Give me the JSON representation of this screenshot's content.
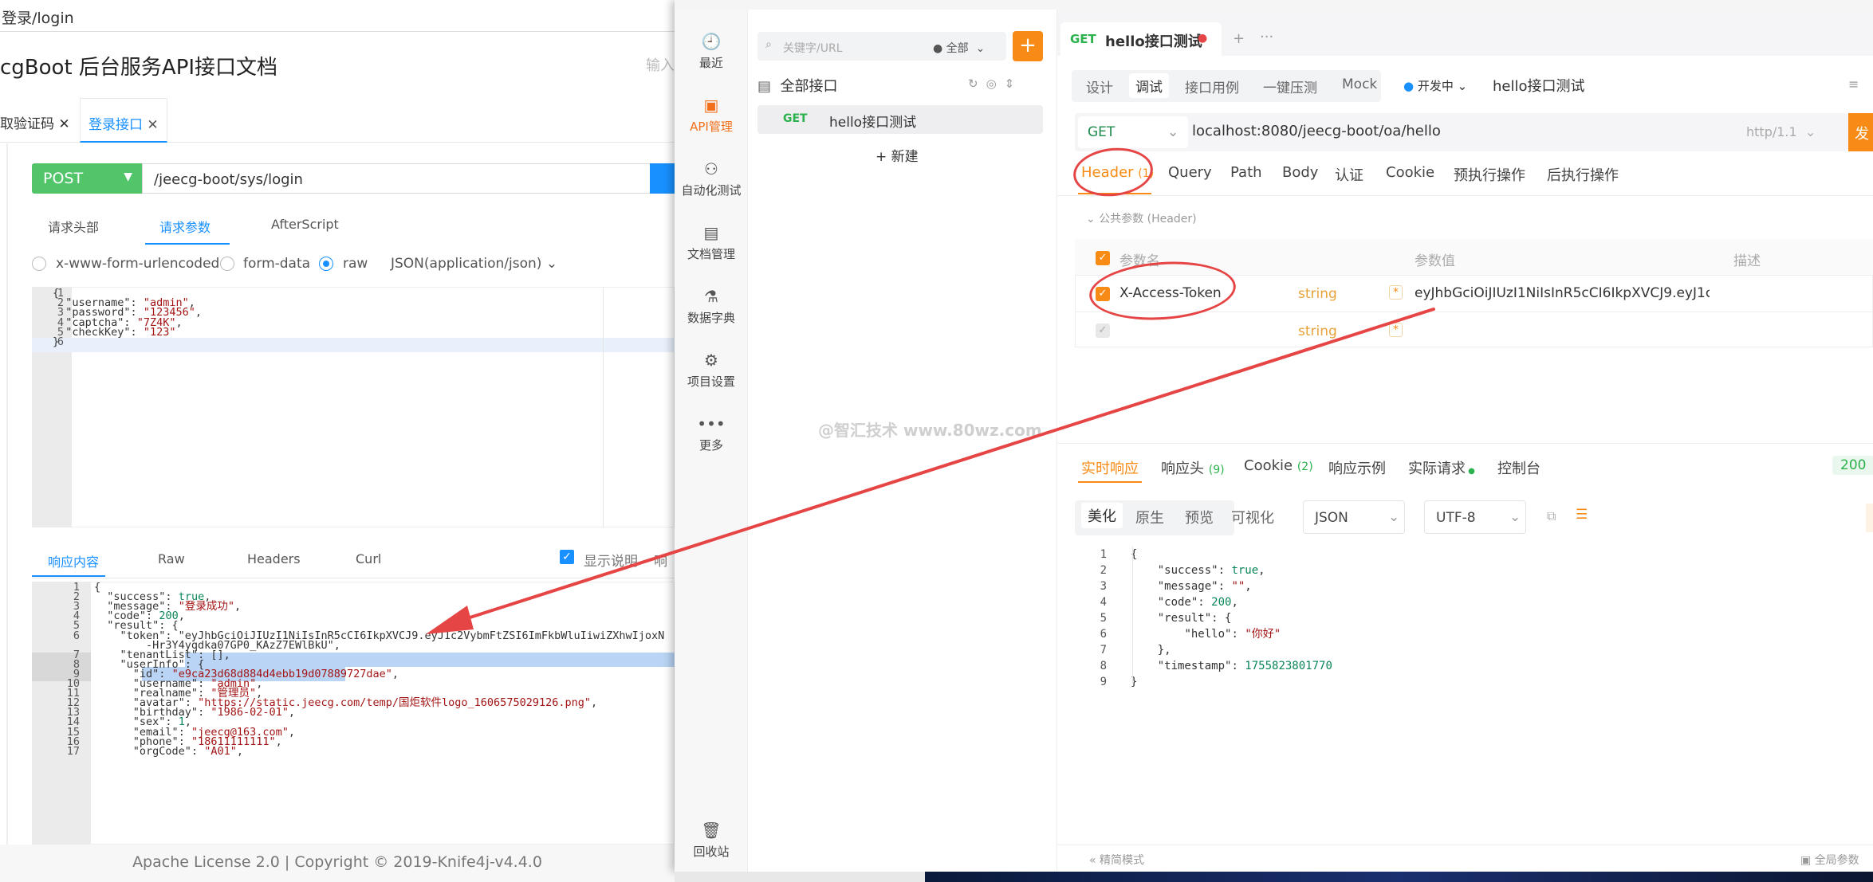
{
  "left": {
    "address": "登录/login",
    "doc_title": "cgBoot 后台服务API接口文档",
    "search_hint": "输入",
    "tabs": [
      "取验证码",
      "登录接口"
    ],
    "method": "POST",
    "url": "/jeecg-boot/sys/login",
    "subtabs": [
      "请求头部",
      "请求参数",
      "AfterScript"
    ],
    "content_types": [
      "x-www-form-urlencoded",
      "form-data",
      "raw",
      "JSON(application/json)"
    ],
    "request_lines": [
      "{",
      "  \"username\": \"admin\",",
      "  \"password\": \"123456\",",
      "  \"captcha\": \"7Z4K\",",
      "  \"checkKey\": \"123\"",
      "}"
    ],
    "response_tabs": [
      "响应内容",
      "Raw",
      "Headers",
      "Curl"
    ],
    "show_desc": "显示说明",
    "show_desc_more": "响",
    "response_lines": [
      {
        "n": "1",
        "t": "{"
      },
      {
        "n": "2",
        "t": "  \"success\": true,"
      },
      {
        "n": "3",
        "t": "  \"message\": \"登录成功\","
      },
      {
        "n": "4",
        "t": "  \"code\": 200,"
      },
      {
        "n": "5",
        "t": "  \"result\": {"
      },
      {
        "n": "6",
        "t": "    \"token\": \"eyJhbGciOiJIUzI1NiIsInR5cCI6IkpXVCJ9.eyJ1c2VybmFtZSI6ImFkbWluIiwiZXhwIjoxN"
      },
      {
        "n": "",
        "t": "        -Hr3Y4yqdka07GP0_KAzZ7EWlBkU\","
      },
      {
        "n": "7",
        "t": "    \"tenantList\": [],"
      },
      {
        "n": "8",
        "t": "    \"userInfo\": {"
      },
      {
        "n": "9",
        "t": "      \"id\": \"e9ca23d68d884d4ebb19d07889727dae\","
      },
      {
        "n": "10",
        "t": "      \"username\": \"admin\","
      },
      {
        "n": "11",
        "t": "      \"realname\": \"管理员\","
      },
      {
        "n": "12",
        "t": "      \"avatar\": \"https://static.jeecg.com/temp/国炬软件logo_1606575029126.png\","
      },
      {
        "n": "13",
        "t": "      \"birthday\": \"1986-02-01\","
      },
      {
        "n": "14",
        "t": "      \"sex\": 1,"
      },
      {
        "n": "15",
        "t": "      \"email\": \"jeecg@163.com\","
      },
      {
        "n": "16",
        "t": "      \"phone\": \"18611111111\","
      },
      {
        "n": "17",
        "t": "      \"orgCode\": \"A01\","
      }
    ],
    "footer": "Apache License 2.0 | Copyright © 2019-Knife4j-v4.4.0"
  },
  "apifox": {
    "rail": [
      "最近",
      "API管理",
      "自动化测试",
      "文档管理",
      "数据字典",
      "项目设置",
      "更多",
      "回收站"
    ],
    "search_placeholder": "关键字/URL",
    "filter": "全部",
    "all_apis": "全部接口",
    "tree_item_method": "GET",
    "tree_item_name": "hello接口测试",
    "new_label": "+ 新建",
    "tab_method": "GET",
    "tab_title": "hello接口测试",
    "segments": [
      "设计",
      "调试",
      "接口用例",
      "一键压测",
      "Mock"
    ],
    "env": "开发中",
    "api_name": "hello接口测试",
    "method": "GET",
    "url": "localhost:8080/jeecg-boot/oa/hello",
    "http_version": "http/1.1",
    "send": "发",
    "param_tabs": [
      "Header",
      "Query",
      "Path",
      "Body",
      "认证",
      "Cookie",
      "预执行操作",
      "后执行操作"
    ],
    "header_count": "(1)",
    "public_params": "公共参数 (Header)",
    "cols": [
      "参数名",
      "参数值",
      "描述"
    ],
    "row_name": "X-Access-Token",
    "row_type": "string",
    "row_value": "eyJhbGciOiJIUzI1NiIsInR5cCI6IkpXVCJ9.eyJ1c2Vy",
    "row2_type": "string",
    "response_tabs": [
      "实时响应",
      "响应头",
      "Cookie",
      "响应示例",
      "实际请求",
      "控制台"
    ],
    "resp_head_count": "(9)",
    "cookie_count": "(2)",
    "status": "200",
    "view_modes": [
      "美化",
      "原生",
      "预览",
      "可视化"
    ],
    "format": "JSON",
    "encoding": "UTF-8",
    "response_lines": [
      {
        "n": "1",
        "t": "{"
      },
      {
        "n": "2",
        "t": "    \"success\": true,"
      },
      {
        "n": "3",
        "t": "    \"message\": \"\","
      },
      {
        "n": "4",
        "t": "    \"code\": 200,"
      },
      {
        "n": "5",
        "t": "    \"result\": {"
      },
      {
        "n": "6",
        "t": "        \"hello\": \"你好\""
      },
      {
        "n": "7",
        "t": "    },"
      },
      {
        "n": "8",
        "t": "    \"timestamp\": 1755823801770"
      },
      {
        "n": "9",
        "t": "}"
      }
    ],
    "bottom_left": "精简模式",
    "bottom_right": "全局参数"
  },
  "watermark": "@智汇技术 www.80wz.com",
  "colors": {
    "accent": "#f78b16",
    "knife_blue": "#1890ff",
    "post_green": "#52c46a",
    "annotation_red": "#e64545"
  }
}
